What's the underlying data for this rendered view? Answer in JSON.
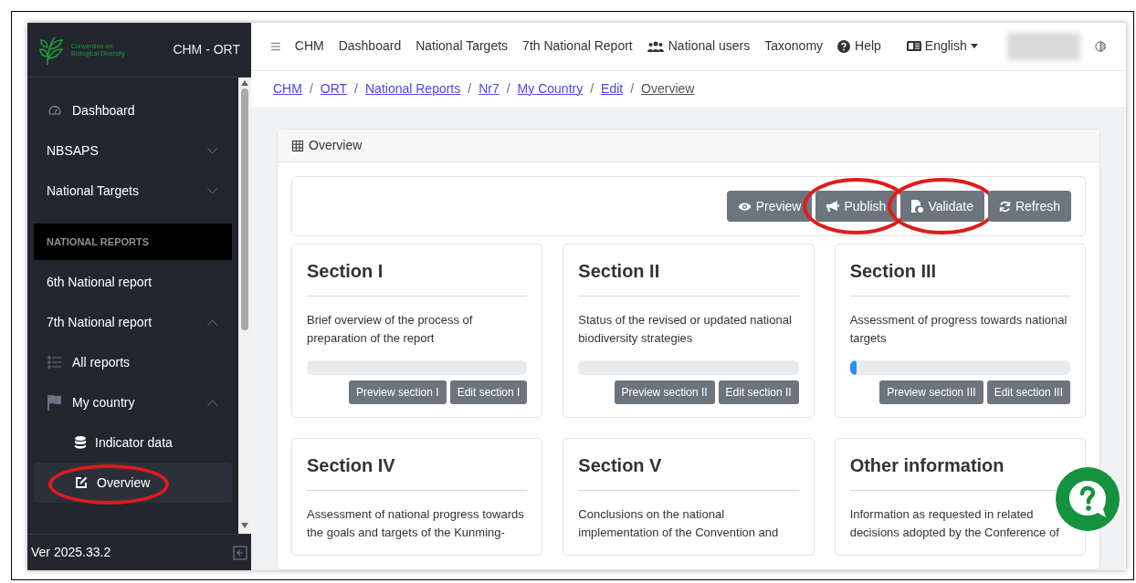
{
  "sidebar": {
    "logo_text": "Convention on Biological Diversity",
    "title": "CHM - ORT",
    "items": [
      {
        "kind": "link",
        "label": "Dashboard",
        "selected": false
      },
      {
        "kind": "group",
        "label": "NBSAPS",
        "expanded": false
      },
      {
        "kind": "group",
        "label": "National Targets",
        "expanded": false
      },
      {
        "kind": "heading",
        "label": "NATIONAL REPORTS"
      },
      {
        "kind": "link",
        "label": "6th National report",
        "selected": false
      },
      {
        "kind": "group",
        "label": "7th National report",
        "expanded": true,
        "children": [
          {
            "kind": "link",
            "label": "All reports",
            "selected": false
          },
          {
            "kind": "group",
            "label": "My country",
            "expanded": true,
            "children": [
              {
                "kind": "link",
                "label": "Indicator data",
                "selected": false
              },
              {
                "kind": "link",
                "label": "Overview",
                "selected": true,
                "annotated": true
              }
            ]
          }
        ]
      }
    ],
    "version": "Ver 2025.33.2"
  },
  "top_nav": {
    "items": [
      {
        "label": "CHM"
      },
      {
        "label": "Dashboard"
      },
      {
        "label": "National Targets"
      },
      {
        "label": "7th National Report"
      },
      {
        "label": "National users"
      },
      {
        "label": "Taxonomy"
      },
      {
        "label": "Help"
      }
    ],
    "language": "English"
  },
  "breadcrumb": [
    {
      "label": "CHM",
      "current": false
    },
    {
      "separator": "/",
      "label": "ORT",
      "current": false
    },
    {
      "separator": "/",
      "label": "National Reports",
      "current": false
    },
    {
      "separator": "/",
      "label": "Nr7",
      "current": false
    },
    {
      "separator": "/",
      "label": "My Country",
      "current": false
    },
    {
      "separator": "/",
      "label": "Edit",
      "current": false
    },
    {
      "separator": "/",
      "label": "Overview",
      "current": true
    }
  ],
  "panel": {
    "title": "Overview",
    "toolbar": [
      {
        "label": "Preview",
        "annotated": false
      },
      {
        "label": "Publish",
        "annotated": true
      },
      {
        "label": "Validate",
        "annotated": true
      },
      {
        "label": "Refresh",
        "annotated": false
      }
    ],
    "sections": [
      {
        "title": "Section I",
        "description": "Brief overview of the process of preparation of the report",
        "level": 0,
        "buttons": [
          "Preview section I",
          "Edit section I"
        ]
      },
      {
        "title": "Section II",
        "description": "Status of the revised or updated national biodiversity strategies",
        "level": 0,
        "buttons": [
          "Preview section II",
          "Edit section II"
        ]
      },
      {
        "title": "Section III",
        "description": "Assessment of progress towards national targets",
        "level": 0.03,
        "buttons": [
          "Preview section III",
          "Edit section III"
        ]
      },
      {
        "title": "Section IV",
        "description": "Assessment of national progress towards the goals and targets of the Kunming-"
      },
      {
        "title": "Section V",
        "description": "Conclusions on the national implementation of the Convention and"
      },
      {
        "title": "Other information",
        "description": "Information as requested in related decisions adopted by the Conference of"
      }
    ]
  }
}
